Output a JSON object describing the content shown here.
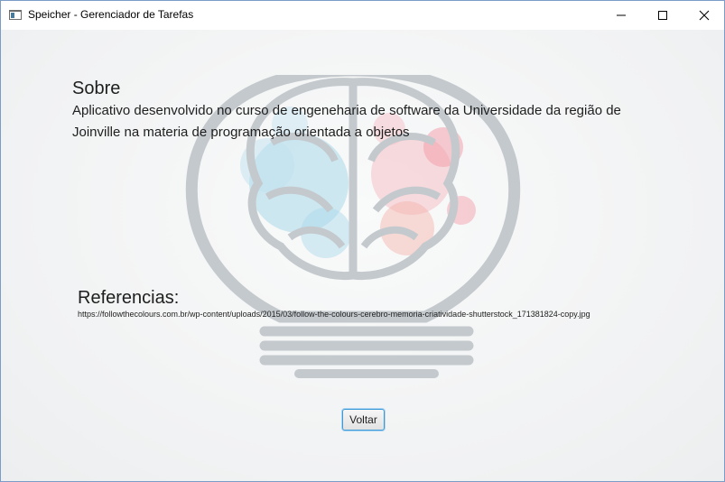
{
  "window": {
    "title": "Speicher - Gerenciador de Tarefas",
    "controls": {
      "minimize": "minimize-icon",
      "maximize": "maximize-icon",
      "close": "close-icon"
    }
  },
  "about": {
    "heading": "Sobre",
    "description": "Aplicativo desenvolvido no curso de engeneharia de software da Universidade da região de Joinville na materia de programação orientada a objetos"
  },
  "references": {
    "heading": "Referencias:",
    "url": "https://followthecolours.com.br/wp-content/uploads/2015/03/follow-the-colours-cerebro-memoria-criatividade-shutterstock_171381824-copy.jpg"
  },
  "actions": {
    "back_label": "Voltar"
  },
  "colors": {
    "accent": "#3c9ad8",
    "bulb_outline": "#c4c9cd",
    "left_brain": "#9fd4e6",
    "right_brain": "#f2a0aa"
  }
}
